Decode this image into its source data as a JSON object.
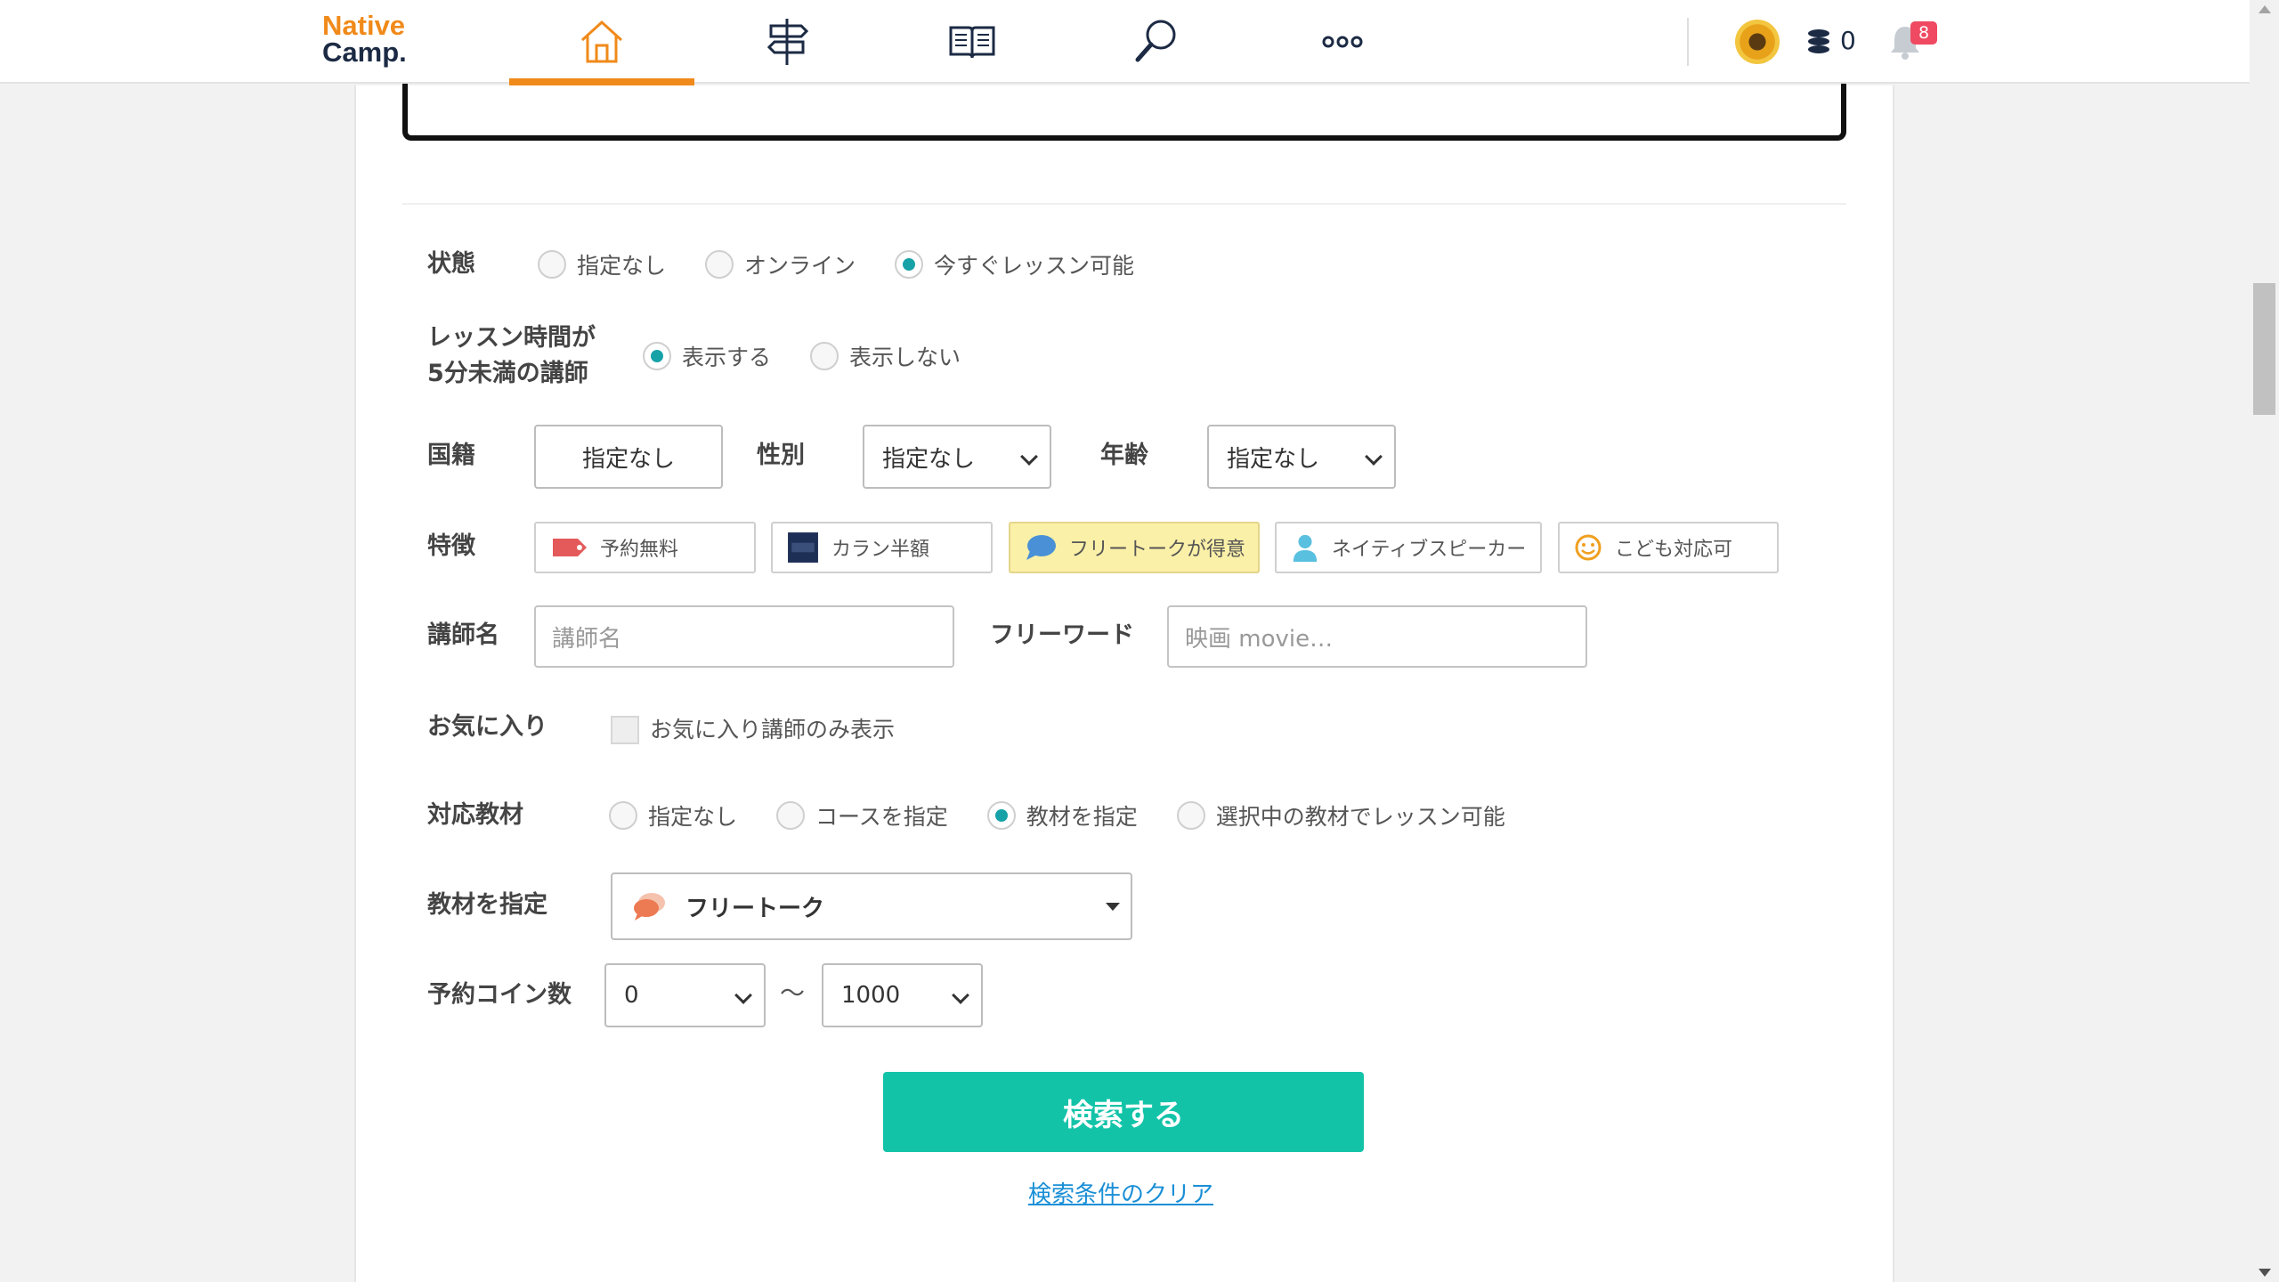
{
  "header": {
    "logo_line1": "Native",
    "logo_line2": "Camp.",
    "nav": [
      {
        "name": "home",
        "icon": "home-icon",
        "active": true
      },
      {
        "name": "signpost",
        "icon": "signpost-icon",
        "active": false
      },
      {
        "name": "book",
        "icon": "book-icon",
        "active": false
      },
      {
        "name": "search",
        "icon": "search-icon",
        "active": false
      },
      {
        "name": "more",
        "icon": "more-icon",
        "active": false
      }
    ],
    "coin_count": "0",
    "notification_count": "8",
    "accent_color": "#f08a1a"
  },
  "form": {
    "status": {
      "label": "状態",
      "options": [
        "指定なし",
        "オンライン",
        "今すぐレッスン可能"
      ],
      "selected": 2
    },
    "short_lesson": {
      "label_line1": "レッスン時間が",
      "label_line2": "5分未満の講師",
      "options": [
        "表示する",
        "表示しない"
      ],
      "selected": 0
    },
    "nationality": {
      "label": "国籍",
      "value": "指定なし"
    },
    "gender": {
      "label": "性別",
      "value": "指定なし"
    },
    "age": {
      "label": "年齢",
      "value": "指定なし"
    },
    "features": {
      "label": "特徴",
      "items": [
        {
          "label": "予約無料",
          "icon": "tag-icon",
          "active": false
        },
        {
          "label": "カラン半額",
          "icon": "callan-book-icon",
          "active": false
        },
        {
          "label": "フリートークが得意",
          "icon": "speech-bubble-icon",
          "active": true
        },
        {
          "label": "ネイティブスピーカー",
          "icon": "person-icon",
          "active": false
        },
        {
          "label": "こども対応可",
          "icon": "smiley-icon",
          "active": false
        }
      ]
    },
    "teacher_name": {
      "label": "講師名",
      "placeholder": "講師名"
    },
    "free_word": {
      "label": "フリーワード",
      "placeholder": "映画 movie…"
    },
    "favorites": {
      "label": "お気に入り",
      "checkbox_label": "お気に入り講師のみ表示"
    },
    "materials": {
      "label": "対応教材",
      "options": [
        "指定なし",
        "コースを指定",
        "教材を指定",
        "選択中の教材でレッスン可能"
      ],
      "selected": 2
    },
    "specify_material": {
      "label": "教材を指定",
      "value": "フリートーク"
    },
    "coins": {
      "label": "予約コイン数",
      "min": "0",
      "separator": "〜",
      "max": "1000"
    },
    "search_button": "検索する",
    "clear_link": "検索条件のクリア",
    "primary_color": "#12c3a8",
    "radio_color": "#17a2a8"
  }
}
